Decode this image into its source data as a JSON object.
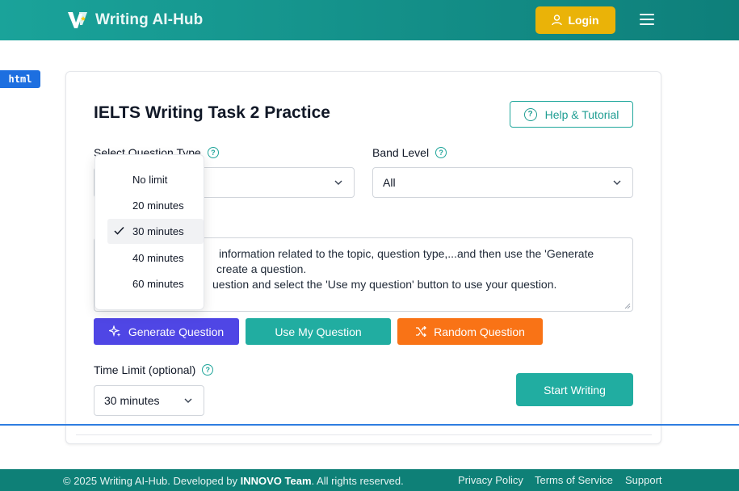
{
  "header": {
    "brand": "Writing AI-Hub",
    "login_label": "Login"
  },
  "badge": "html",
  "page": {
    "title": "IELTS Writing Task 2 Practice",
    "help_label": "Help & Tutorial"
  },
  "form": {
    "question_type_label": "Select Question Type",
    "band_level_label": "Band Level",
    "band_level_value": "All",
    "textarea_lines": [
      "information related to the topic, question type,...and then use the 'Generate",
      "create a question.",
      "uestion and select the 'Use my question' button to use your question."
    ],
    "time_limit_label": "Time Limit (optional)",
    "time_limit_value": "30 minutes"
  },
  "buttons": {
    "generate": "Generate Question",
    "use_mine": "Use My Question",
    "random": "Random Question",
    "start": "Start Writing"
  },
  "dropdown": {
    "options": [
      "No limit",
      "20 minutes",
      "30 minutes",
      "40 minutes",
      "60 minutes"
    ],
    "selected": "30 minutes"
  },
  "footer": {
    "copyright_prefix": "© 2025 Writing AI-Hub. Developed by",
    "team": "INNOVO Team",
    "copyright_suffix": ". All rights reserved.",
    "links": [
      "Privacy Policy",
      "Terms of Service",
      "Support"
    ]
  },
  "colors": {
    "header": "#1aa39a",
    "login": "#eab308",
    "generate": "#4f46e5",
    "teal_button": "#21ada1",
    "random": "#f97316",
    "footer": "#0e8077"
  }
}
